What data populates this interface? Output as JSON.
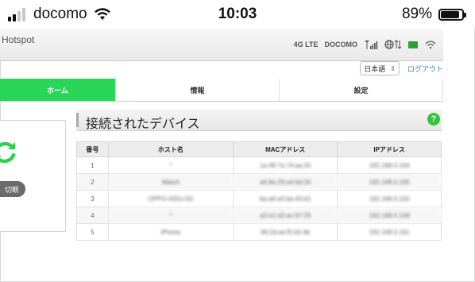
{
  "status_bar": {
    "carrier": "docomo",
    "time": "10:03",
    "battery": "89%",
    "battery_level": 0.89
  },
  "header": {
    "title": "Hotspot",
    "network_type": "4G LTE",
    "operator": "DOCOMO"
  },
  "lang": {
    "selected": "日本語",
    "logout": "ログアウト"
  },
  "tabs": [
    {
      "label": "ホーム",
      "active": true
    },
    {
      "label": "情報",
      "active": false
    },
    {
      "label": "設定",
      "active": false
    }
  ],
  "left_panel": {
    "disconnect_label": "切断"
  },
  "section": {
    "title": "接続されたデバイス",
    "help": "?"
  },
  "table": {
    "headers": [
      "番号",
      "ホスト名",
      "MACアドレス",
      "IPアドレス"
    ],
    "rows": [
      {
        "no": "1",
        "host": "*",
        "mac": "1a:49:7a:74:aa:20",
        "ip": "192.168.0.164"
      },
      {
        "no": "2",
        "host": "Watch",
        "mac": "a6:8e:29:a4:6d:30",
        "ip": "192.168.0.165"
      },
      {
        "no": "3",
        "host": "OPPO-A55s-5G",
        "mac": "ba:a6:e0:ba:43:d1",
        "ip": "192.168.0.150"
      },
      {
        "no": "4",
        "host": "*",
        "mac": "a2:e1:d2:ac:97:29",
        "ip": "192.168.0.109"
      },
      {
        "no": "5",
        "host": "iPhone",
        "mac": "96:2d:ae:f5:b5:4b",
        "ip": "192.168.0.181"
      }
    ]
  },
  "colors": {
    "tab_active": "#29d658",
    "help": "#36c43a",
    "link": "#3b87c4"
  }
}
